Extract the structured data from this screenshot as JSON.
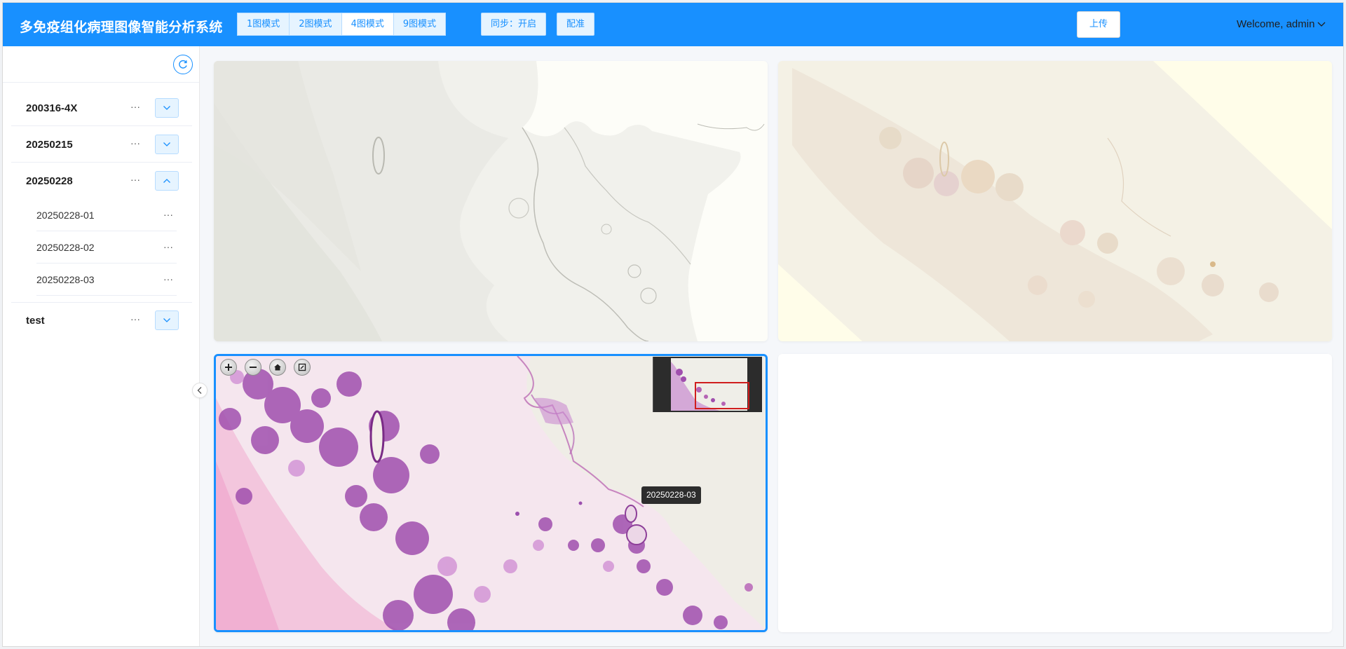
{
  "header": {
    "title": "多免疫组化病理图像智能分析系统",
    "modes": [
      "1图模式",
      "2图模式",
      "4图模式",
      "9图模式"
    ],
    "sync_label": "同步：开启",
    "register_label": "配准",
    "upload_label": "上传",
    "user_label": "Welcome, admin"
  },
  "sidebar": {
    "groups": [
      {
        "name": "200316-4X",
        "expanded": false,
        "children": []
      },
      {
        "name": "20250215",
        "expanded": false,
        "children": []
      },
      {
        "name": "20250228",
        "expanded": true,
        "children": [
          "20250228-01",
          "20250228-02",
          "20250228-03"
        ]
      },
      {
        "name": "test",
        "expanded": false,
        "children": []
      }
    ],
    "more_label": "···"
  },
  "viewer": {
    "active_slide_tooltip": "20250228-03",
    "controls": [
      "zoom-in-icon",
      "zoom-out-icon",
      "home-icon",
      "fullscreen-icon"
    ]
  },
  "colors": {
    "primary": "#1890ff",
    "header_bg": "#1890ff",
    "he_stain": "#b565b8",
    "ihc_bg": "#f5f2e4"
  }
}
